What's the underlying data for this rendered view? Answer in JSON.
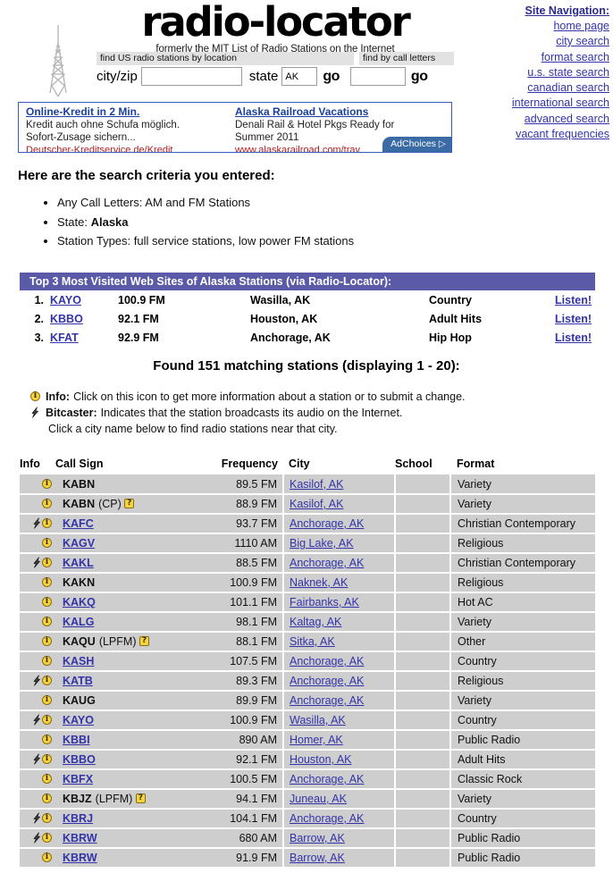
{
  "header": {
    "brand_title": "radio-locator",
    "brand_subtitle": "formerly the MIT List of Radio Stations on the Internet",
    "tower_icon": "radio-tower-icon"
  },
  "search": {
    "location_bar_label": "find US radio stations by location",
    "call_bar_label": "find by call letters",
    "city_label": "city/zip",
    "city_value": "",
    "city_placeholder": "",
    "state_label": "state",
    "state_value": "AK",
    "call_value": "",
    "go_label": "go",
    "go_label_2": "go"
  },
  "nav": {
    "title": "Site Navigation:",
    "items": [
      "home page",
      "city search",
      "format search",
      "u.s. state search",
      "canadian search",
      "international search",
      "advanced search",
      "vacant frequencies"
    ]
  },
  "ad": {
    "left": {
      "headline": "Online-Kredit in 2 Min.",
      "line1": "Kredit auch ohne Schufa möglich.",
      "line2": "Sofort-Zusage sichern...",
      "url": "Deutscher-Kreditservice.de/Kredit"
    },
    "right": {
      "headline": "Alaska Railroad Vacations",
      "line1": "Denali Rail & Hotel Pkgs Ready for",
      "line2": "Summer 2011",
      "url": "www.alaskarailroad.com/trav"
    },
    "adchoices_label": "AdChoices",
    "adchoices_icon": "adchoices-triangle-icon"
  },
  "criteria": {
    "title": "Here are the search criteria you entered:",
    "items": [
      {
        "label": "Any Call Letters:",
        "value": "AM and FM Stations",
        "bold_value": false
      },
      {
        "label": "State:",
        "value": "Alaska",
        "bold_value": true
      },
      {
        "label": "Station Types:",
        "value": "full service stations, low power FM stations",
        "bold_value": false
      }
    ]
  },
  "top3": {
    "heading": "Top 3 Most Visited Web Sites of Alaska Stations (via Radio-Locator):",
    "rows": [
      {
        "rank": "1.",
        "call": "KAYO",
        "frequency": "100.9 FM",
        "city": "Wasilla, AK",
        "format": "Country",
        "listen": "Listen!"
      },
      {
        "rank": "2.",
        "call": "KBBO",
        "frequency": "92.1 FM",
        "city": "Houston, AK",
        "format": "Adult Hits",
        "listen": "Listen!"
      },
      {
        "rank": "3.",
        "call": "KFAT",
        "frequency": "92.9 FM",
        "city": "Anchorage, AK",
        "format": "Hip Hop",
        "listen": "Listen!"
      }
    ]
  },
  "results_summary": "Found 151 matching stations (displaying 1 - 20):",
  "legend": {
    "info_icon": "info-icon",
    "info_label": "Info:",
    "info_text": "Click on this icon to get more information about a station or to submit a change.",
    "bitcaster_icon": "bitcaster-bolt-icon",
    "bitcaster_label": "Bitcaster:",
    "bitcaster_text": "Indicates that the station broadcasts its audio on the Internet.",
    "note": "Click a city name below to find radio stations near that city."
  },
  "table": {
    "columns": [
      "Info",
      "Call Sign",
      "Frequency",
      "City",
      "School",
      "Format"
    ],
    "rows": [
      {
        "bitcaster": false,
        "call": "KABN",
        "call_link": false,
        "tag": "",
        "has_q": false,
        "frequency": "89.5 FM",
        "city": "Kasilof, AK",
        "school": "",
        "format": "Variety"
      },
      {
        "bitcaster": false,
        "call": "KABN",
        "call_link": false,
        "tag": "(CP)",
        "has_q": true,
        "frequency": "88.9 FM",
        "city": "Kasilof, AK",
        "school": "",
        "format": "Variety"
      },
      {
        "bitcaster": true,
        "call": "KAFC",
        "call_link": true,
        "tag": "",
        "has_q": false,
        "frequency": "93.7 FM",
        "city": "Anchorage, AK",
        "school": "",
        "format": "Christian Contemporary"
      },
      {
        "bitcaster": false,
        "call": "KAGV",
        "call_link": true,
        "tag": "",
        "has_q": false,
        "frequency": "1110 AM",
        "city": "Big Lake, AK",
        "school": "",
        "format": "Religious"
      },
      {
        "bitcaster": true,
        "call": "KAKL",
        "call_link": true,
        "tag": "",
        "has_q": false,
        "frequency": "88.5 FM",
        "city": "Anchorage, AK",
        "school": "",
        "format": "Christian Contemporary"
      },
      {
        "bitcaster": false,
        "call": "KAKN",
        "call_link": false,
        "tag": "",
        "has_q": false,
        "frequency": "100.9 FM",
        "city": "Naknek, AK",
        "school": "",
        "format": "Religious"
      },
      {
        "bitcaster": false,
        "call": "KAKQ",
        "call_link": true,
        "tag": "",
        "has_q": false,
        "frequency": "101.1 FM",
        "city": "Fairbanks, AK",
        "school": "",
        "format": "Hot AC"
      },
      {
        "bitcaster": false,
        "call": "KALG",
        "call_link": true,
        "tag": "",
        "has_q": false,
        "frequency": "98.1 FM",
        "city": "Kaltag, AK",
        "school": "",
        "format": "Variety"
      },
      {
        "bitcaster": false,
        "call": "KAQU",
        "call_link": false,
        "tag": "(LPFM)",
        "has_q": true,
        "frequency": "88.1 FM",
        "city": "Sitka, AK",
        "school": "",
        "format": "Other"
      },
      {
        "bitcaster": false,
        "call": "KASH",
        "call_link": true,
        "tag": "",
        "has_q": false,
        "frequency": "107.5 FM",
        "city": "Anchorage, AK",
        "school": "",
        "format": "Country"
      },
      {
        "bitcaster": true,
        "call": "KATB",
        "call_link": true,
        "tag": "",
        "has_q": false,
        "frequency": "89.3 FM",
        "city": "Anchorage, AK",
        "school": "",
        "format": "Religious"
      },
      {
        "bitcaster": false,
        "call": "KAUG",
        "call_link": false,
        "tag": "",
        "has_q": false,
        "frequency": "89.9 FM",
        "city": "Anchorage, AK",
        "school": "",
        "format": "Variety"
      },
      {
        "bitcaster": true,
        "call": "KAYO",
        "call_link": true,
        "tag": "",
        "has_q": false,
        "frequency": "100.9 FM",
        "city": "Wasilla, AK",
        "school": "",
        "format": "Country"
      },
      {
        "bitcaster": false,
        "call": "KBBI",
        "call_link": true,
        "tag": "",
        "has_q": false,
        "frequency": "890 AM",
        "city": "Homer, AK",
        "school": "",
        "format": "Public Radio"
      },
      {
        "bitcaster": true,
        "call": "KBBO",
        "call_link": true,
        "tag": "",
        "has_q": false,
        "frequency": "92.1 FM",
        "city": "Houston, AK",
        "school": "",
        "format": "Adult Hits"
      },
      {
        "bitcaster": false,
        "call": "KBFX",
        "call_link": true,
        "tag": "",
        "has_q": false,
        "frequency": "100.5 FM",
        "city": "Anchorage, AK",
        "school": "",
        "format": "Classic Rock"
      },
      {
        "bitcaster": false,
        "call": "KBJZ",
        "call_link": false,
        "tag": "(LPFM)",
        "has_q": true,
        "frequency": "94.1 FM",
        "city": "Juneau, AK",
        "school": "",
        "format": "Variety"
      },
      {
        "bitcaster": true,
        "call": "KBRJ",
        "call_link": true,
        "tag": "",
        "has_q": false,
        "frequency": "104.1 FM",
        "city": "Anchorage, AK",
        "school": "",
        "format": "Country"
      },
      {
        "bitcaster": true,
        "call": "KBRW",
        "call_link": true,
        "tag": "",
        "has_q": false,
        "frequency": "680 AM",
        "city": "Barrow, AK",
        "school": "",
        "format": "Public Radio"
      },
      {
        "bitcaster": false,
        "call": "KBRW",
        "call_link": true,
        "tag": "",
        "has_q": false,
        "frequency": "91.9 FM",
        "city": "Barrow, AK",
        "school": "",
        "format": "Public Radio"
      }
    ]
  },
  "colors": {
    "link": "#3333aa",
    "top3_header_bg": "#5a5aa8",
    "row_bg": "#cecece",
    "ad_border": "#3b5bbf",
    "icon_yellow": "#f5d33a"
  }
}
